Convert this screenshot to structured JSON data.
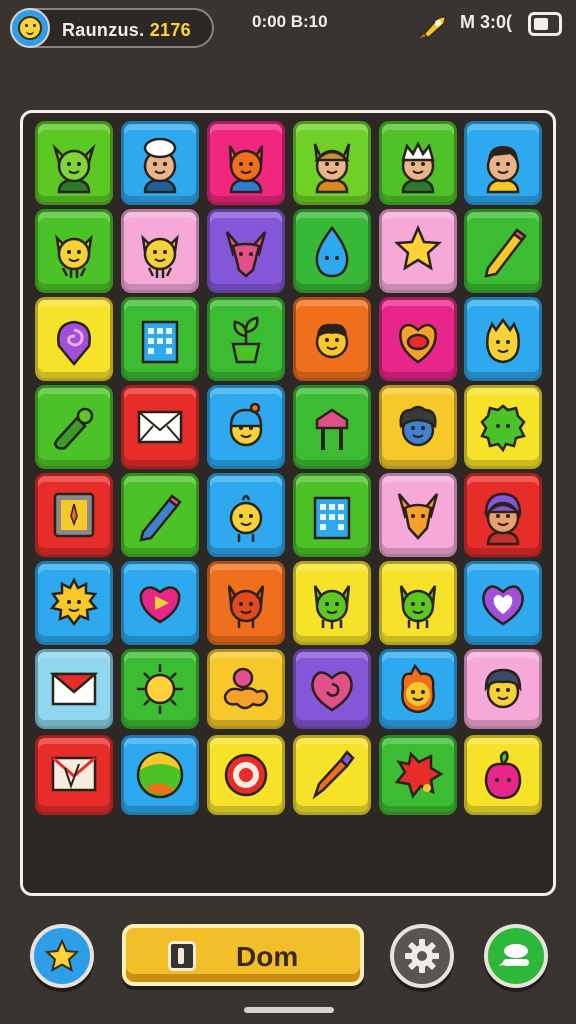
{
  "status_bar": {
    "player_name": "Raunzus.",
    "player_code": "2176",
    "center_text": "0:00 B:10",
    "right_text": "M 3:0("
  },
  "board": {
    "tiles": [
      {
        "name": "green-goblin-avatar-tile",
        "color": "#5cc824",
        "icon": "goblin"
      },
      {
        "name": "chef-avatar-tile",
        "color": "#2ea9ef",
        "icon": "chef"
      },
      {
        "name": "orange-cat-avatar-tile",
        "color": "#f0267f",
        "icon": "cat"
      },
      {
        "name": "viking-avatar-tile",
        "color": "#6fd128",
        "icon": "viking"
      },
      {
        "name": "white-hair-avatar-tile",
        "color": "#4fc22a",
        "icon": "whitehair"
      },
      {
        "name": "dark-hair-avatar-tile",
        "color": "#2ea9ef",
        "icon": "boy"
      },
      {
        "name": "yellow-cat-tile",
        "color": "#4cc229",
        "icon": "yellowcat"
      },
      {
        "name": "pink-cat-tile",
        "color": "#f6a9d8",
        "icon": "yellowcat"
      },
      {
        "name": "purple-fox-tile",
        "color": "#8457d8",
        "icon": "fox"
      },
      {
        "name": "blue-drop-tile",
        "color": "#38b837",
        "icon": "drop"
      },
      {
        "name": "star-tile",
        "color": "#f6a9d8",
        "icon": "star"
      },
      {
        "name": "pencil-tile",
        "color": "#3cbc33",
        "icon": "pencil"
      },
      {
        "name": "swirl-pin-tile",
        "color": "#f7e22a",
        "icon": "swirl"
      },
      {
        "name": "building-tile",
        "color": "#3cbc33",
        "icon": "building"
      },
      {
        "name": "plant-pot-tile",
        "color": "#3cbc33",
        "icon": "plant"
      },
      {
        "name": "grumpy-face-tile",
        "color": "#f06f1c",
        "icon": "grumpy"
      },
      {
        "name": "heart-face-tile",
        "color": "#e8268a",
        "icon": "heartface"
      },
      {
        "name": "round-face-tile",
        "color": "#2ea9ef",
        "icon": "roundface"
      },
      {
        "name": "green-bottle-tile",
        "color": "#4cc229",
        "icon": "bottle"
      },
      {
        "name": "mail-tile",
        "color": "#e72d2a",
        "icon": "mail"
      },
      {
        "name": "beanie-face-tile",
        "color": "#2ea9ef",
        "icon": "beanie"
      },
      {
        "name": "sign-tile",
        "color": "#3cbc33",
        "icon": "sign"
      },
      {
        "name": "curly-hair-face-tile",
        "color": "#f6c82a",
        "icon": "curly"
      },
      {
        "name": "green-blob-tile",
        "color": "#f7e22a",
        "icon": "greenblob"
      },
      {
        "name": "picture-frame-tile",
        "color": "#e72d2a",
        "icon": "frame"
      },
      {
        "name": "blue-pencil-tile",
        "color": "#4cc229",
        "icon": "bluepencil"
      },
      {
        "name": "chick-face-tile",
        "color": "#2ea9ef",
        "icon": "chick"
      },
      {
        "name": "tower-tile",
        "color": "#4cc229",
        "icon": "building"
      },
      {
        "name": "orange-fox-tile",
        "color": "#f6a9d8",
        "icon": "orangefox"
      },
      {
        "name": "hooded-face-tile",
        "color": "#e72d2a",
        "icon": "hooded"
      },
      {
        "name": "sun-face-tile",
        "color": "#2ea9ef",
        "icon": "sunface"
      },
      {
        "name": "heart-bubble-tile",
        "color": "#2ea9ef",
        "icon": "heartbubble"
      },
      {
        "name": "red-cat-tile",
        "color": "#f06f1c",
        "icon": "redcat"
      },
      {
        "name": "green-cat-tile",
        "color": "#f7e22a",
        "icon": "greencat"
      },
      {
        "name": "green-cat-2-tile",
        "color": "#f7e22a",
        "icon": "greencat"
      },
      {
        "name": "purple-heart-tile",
        "color": "#2ea9ef",
        "icon": "purpleheart"
      },
      {
        "name": "red-mail-tile",
        "color": "#8ed7ef",
        "icon": "redmail"
      },
      {
        "name": "sun-tile",
        "color": "#3cbc33",
        "icon": "sun"
      },
      {
        "name": "balloon-tile",
        "color": "#f6c82a",
        "icon": "balloon"
      },
      {
        "name": "heart-swirl-tile",
        "color": "#8457d8",
        "icon": "heartswirl"
      },
      {
        "name": "red-flame-face-tile",
        "color": "#2ea9ef",
        "icon": "flameface"
      },
      {
        "name": "blue-hair-face-tile",
        "color": "#f6a9d8",
        "icon": "bluehair"
      },
      {
        "name": "letter-tile",
        "color": "#e72d2a",
        "icon": "letter"
      },
      {
        "name": "ball-tile",
        "color": "#2ea9ef",
        "icon": "ball"
      },
      {
        "name": "target-tile",
        "color": "#f7e22a",
        "icon": "target"
      },
      {
        "name": "paintbrush-tile",
        "color": "#f7e22a",
        "icon": "brush"
      },
      {
        "name": "red-splat-tile",
        "color": "#3cbc33",
        "icon": "splat"
      },
      {
        "name": "pink-fruit-tile",
        "color": "#f7e22a",
        "icon": "fruit"
      }
    ]
  },
  "bottom_bar": {
    "main_button_label": "Dom",
    "star_button_color": "#2e9ee8",
    "settings_button_color": "#5a5552",
    "chat_button_color": "#2db83a"
  }
}
